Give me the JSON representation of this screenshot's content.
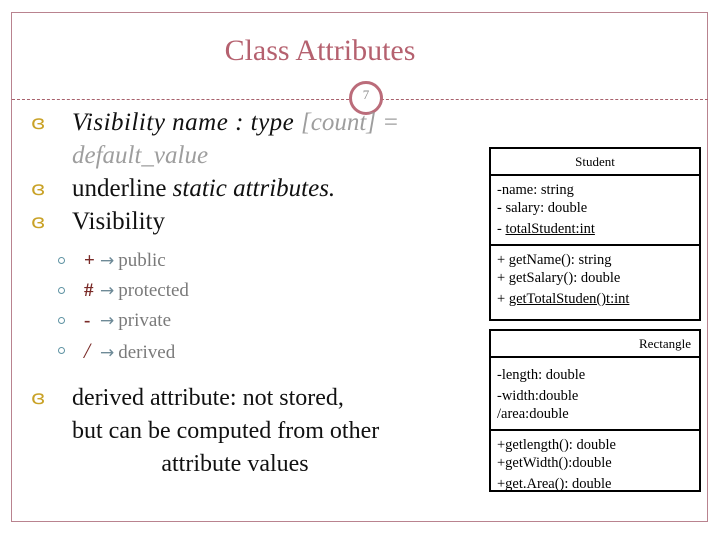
{
  "slide": {
    "title": "Class Attributes",
    "slide_number": "7",
    "accent_color": "#b5616f",
    "frame_color": "#b9838f",
    "bullet_color": "#c9a227",
    "subbullet_color": "#5f93a3",
    "symbol_color": "#7a2b28",
    "muted_text_color": "#7a7a7a"
  },
  "bullets": [
    {
      "glyph": "ɞ",
      "segments": [
        {
          "text": "Visibility  name :  type ",
          "style": "italic-dark"
        },
        {
          "text": "[count] = default_value",
          "style": "italic-gray"
        }
      ]
    },
    {
      "glyph": "ɞ",
      "segments": [
        {
          "text": "underline ",
          "style": "plain-dark"
        },
        {
          "text": "static attributes.",
          "style": "italic-dark"
        }
      ]
    },
    {
      "glyph": "ɞ",
      "segments": [
        {
          "text": "Visibility",
          "style": "plain-dark"
        }
      ]
    }
  ],
  "visibility_list": [
    {
      "symbol": "+",
      "arrow": "→",
      "meaning": "public"
    },
    {
      "symbol": "#",
      "arrow": "→",
      "meaning": "protected"
    },
    {
      "symbol": "-",
      "arrow": "→",
      "meaning": "private"
    },
    {
      "symbol": "/",
      "arrow": "→",
      "meaning": "derived"
    }
  ],
  "derived_note": {
    "glyph": "ɞ",
    "line1": "derived attribute: not stored,",
    "line2": "but can be computed from other",
    "line3": "attribute values"
  },
  "uml": {
    "student": {
      "name": "Student",
      "attributes": [
        {
          "text": "-name: string",
          "underlined": false
        },
        {
          "text": "- salary: double",
          "underlined": false
        },
        {
          "text": "- ",
          "underlined_text": "totalStudent:int",
          "underlined": true
        }
      ],
      "operations": [
        {
          "text": "+ getName(): string",
          "underlined": false
        },
        {
          "text": "+ getSalary(): double",
          "underlined": false
        },
        {
          "text": " + ",
          "underlined_text": "getTotalStuden()t:int",
          "underlined": true
        }
      ]
    },
    "rectangle": {
      "name": "Rectangle",
      "attributes": [
        {
          "text": "-length: double",
          "underlined": false
        },
        {
          "text": "-width:double",
          "underlined": false
        },
        {
          "text": "/area:double",
          "underlined": false
        }
      ],
      "operations": [
        {
          "text": "+getlength(): double",
          "underlined": false
        },
        {
          "text": "+getWidth():double",
          "underlined": false
        },
        {
          "text": "+get.Area(): double",
          "underlined": false
        }
      ]
    }
  }
}
